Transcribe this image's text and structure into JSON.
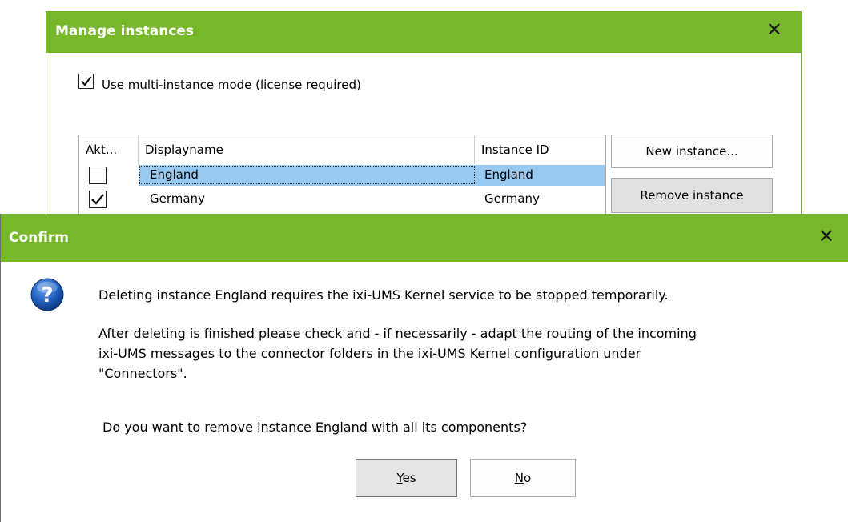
{
  "manage_dialog": {
    "title": "Manage instances",
    "close_glyph": "✕",
    "multi_instance_label": "Use multi-instance mode (license required)",
    "multi_instance_checked": true,
    "table": {
      "columns": [
        "Akt...",
        "Displayname",
        "Instance ID"
      ],
      "rows": [
        {
          "active": false,
          "displayname": "England",
          "instance_id": "England",
          "selected": true
        },
        {
          "active": true,
          "displayname": "Germany",
          "instance_id": "Germany",
          "selected": false
        }
      ]
    },
    "new_instance_button": "New instance...",
    "remove_instance_button": "Remove instance"
  },
  "confirm_dialog": {
    "title": "Confirm",
    "close_glyph": "✕",
    "icon": "question-icon",
    "message_line_1": "Deleting instance England requires the ixi-UMS Kernel service to be stopped temporarily.",
    "message_para_2": {
      "line_1": "After deleting is finished please check and - if necessarily - adapt the routing of the incoming",
      "line_2": "ixi-UMS messages to the connector folders in the ixi-UMS Kernel configuration under",
      "line_3": "\"Connectors\"."
    },
    "question": "Do you want to remove instance England with all its components?",
    "yes_button": {
      "mnemonic": "Y",
      "rest": "es"
    },
    "no_button": {
      "mnemonic": "N",
      "rest": "o"
    }
  },
  "colors": {
    "titlebar": "#76b82a",
    "selection": "#99c9ef"
  }
}
